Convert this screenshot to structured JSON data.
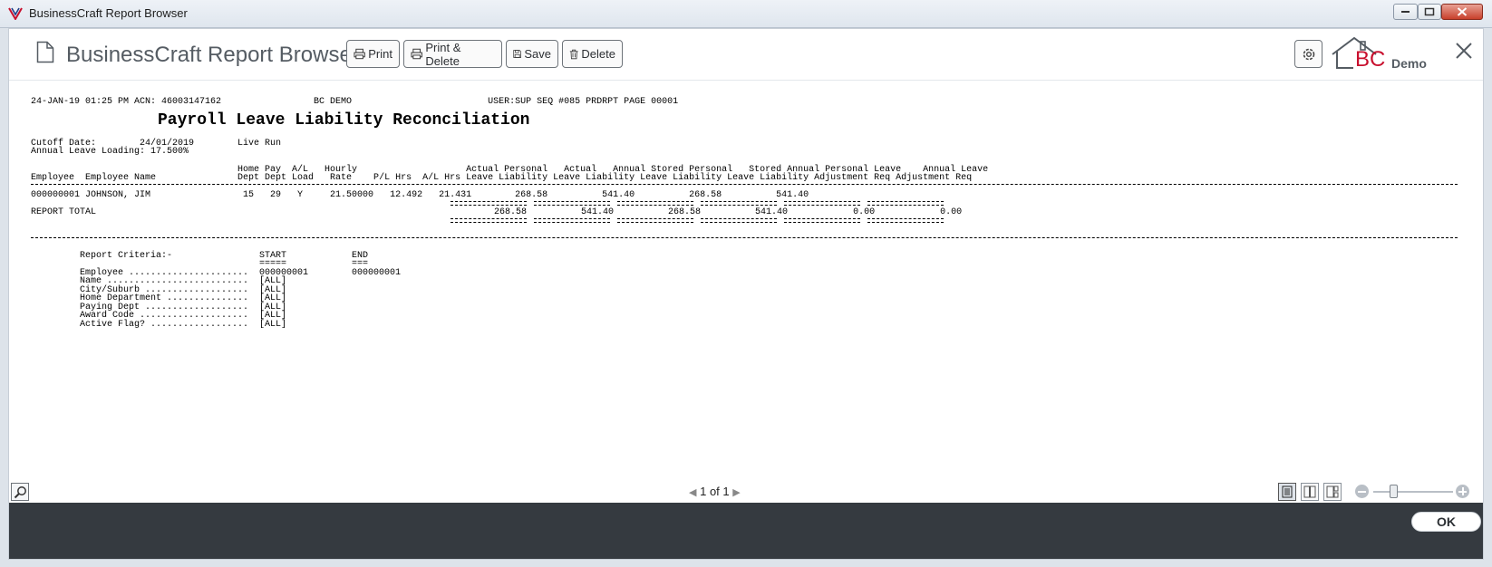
{
  "window": {
    "title": "BusinessCraft Report Browser"
  },
  "toolbar": {
    "title": "BusinessCraft Report Browser",
    "print_label": "Print",
    "print_delete_label": "Print & Delete",
    "save_label": "Save",
    "delete_label": "Delete",
    "brand_bc": "BC",
    "brand_demo": "Demo"
  },
  "report": {
    "header_line": "24-JAN-19 01:25 PM ACN: 46003147162                 BC DEMO                         USER:SUP SEQ #085 PRDRPT PAGE 00001",
    "title": "Payroll Leave Liability Reconciliation",
    "cutoff_line": "Cutoff Date:        24/01/2019        Live Run",
    "loading_line": "Annual Leave Loading: 17.500%",
    "col_header_1": "                                      Home Pay  A/L   Hourly                    Actual Personal   Actual   Annual Stored Personal   Stored Annual Personal Leave    Annual Leave",
    "col_header_2": "Employee  Employee Name               Dept Dept Load   Rate    P/L Hrs  A/L Hrs Leave Liability Leave Liability Leave Liability Leave Liability Adjustment Req Adjustment Req",
    "row_1": "000000001 JOHNSON, JIM                 15   29   Y     21.50000   12.492   21.431        268.58          541.40          268.58          541.40",
    "total_label": "REPORT TOTAL",
    "total_values": "        268.58          541.40          268.58          541.40            0.00            0.00",
    "criteria_header": "Report Criteria:-                START            END",
    "criteria_underline": "                                 =====            ===",
    "criteria": [
      "Employee ......................  000000001        000000001",
      "Name ..........................  [ALL]",
      "City/Suburb ...................  [ALL]",
      "Home Department ...............  [ALL]",
      "Paying Dept ...................  [ALL]",
      "Award Code ....................  [ALL]",
      "Active Flag? ..................  [ALL]"
    ]
  },
  "pager": {
    "current": "1",
    "of_label": "of",
    "total": "1"
  },
  "footer": {
    "ok_label": "OK"
  }
}
